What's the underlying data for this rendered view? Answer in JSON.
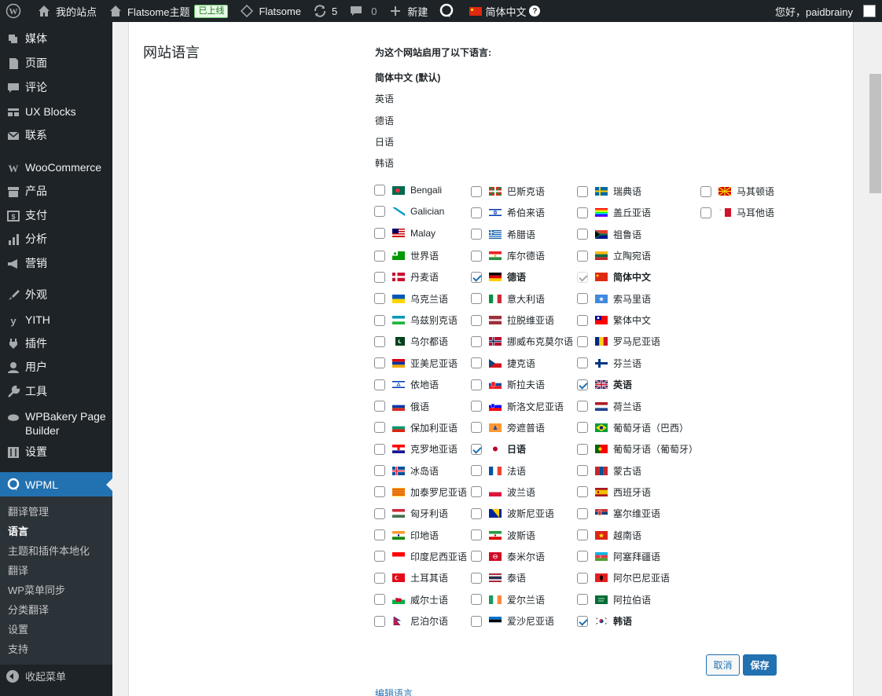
{
  "adminbar": {
    "site_name": "我的站点",
    "theme_name": "Flatsome主题",
    "live_badge": "已上线",
    "flatsome": "Flatsome",
    "updates_count": "5",
    "comments_count": "0",
    "new_label": "新建",
    "language": "简体中文",
    "help": "?",
    "greeting": "您好，paidbrainy"
  },
  "sidebar": {
    "items": [
      {
        "label": "媒体",
        "icon": "media-icon"
      },
      {
        "label": "页面",
        "icon": "page-icon"
      },
      {
        "label": "评论",
        "icon": "comment-icon"
      },
      {
        "label": "UX Blocks",
        "icon": "blocks-icon"
      },
      {
        "label": "联系",
        "icon": "mail-icon"
      },
      {
        "label": "WooCommerce",
        "icon": "woo-icon"
      },
      {
        "label": "产品",
        "icon": "archive-icon"
      },
      {
        "label": "支付",
        "icon": "payment-icon"
      },
      {
        "label": "分析",
        "icon": "chart-icon"
      },
      {
        "label": "营销",
        "icon": "megaphone-icon"
      },
      {
        "label": "外观",
        "icon": "brush-icon"
      },
      {
        "label": "YITH",
        "icon": "yith-icon"
      },
      {
        "label": "插件",
        "icon": "plugin-icon"
      },
      {
        "label": "用户",
        "icon": "user-icon"
      },
      {
        "label": "工具",
        "icon": "wrench-icon"
      },
      {
        "label": "WPBakery Page Builder",
        "icon": "wpbakery-icon"
      },
      {
        "label": "设置",
        "icon": "settings-icon"
      },
      {
        "label": "WPML",
        "icon": "wpml-icon"
      }
    ],
    "submenu": [
      "翻译管理",
      "语言",
      "主题和插件本地化",
      "翻译",
      "WP菜单同步",
      "分类翻译",
      "设置",
      "支持"
    ],
    "collapse": "收起菜单"
  },
  "main": {
    "section_title": "网站语言",
    "enabled_heading": "为这个网站启用了以下语言:",
    "enabled_languages": [
      "简体中文 (默认)",
      "英语",
      "德语",
      "日语",
      "韩语"
    ],
    "columns": [
      [
        {
          "name": "Bengali",
          "checked": false,
          "flag": "bd"
        },
        {
          "name": "Galician",
          "checked": false,
          "flag": "gl"
        },
        {
          "name": "Malay",
          "checked": false,
          "flag": "my"
        },
        {
          "name": "世界语",
          "checked": false,
          "flag": "eo"
        },
        {
          "name": "丹麦语",
          "checked": false,
          "flag": "dk"
        },
        {
          "name": "乌克兰语",
          "checked": false,
          "flag": "ua"
        },
        {
          "name": "乌兹别克语",
          "checked": false,
          "flag": "uz"
        },
        {
          "name": "乌尔都语",
          "checked": false,
          "flag": "pk"
        },
        {
          "name": "亚美尼亚语",
          "checked": false,
          "flag": "am"
        },
        {
          "name": "依地语",
          "checked": false,
          "flag": "yi"
        },
        {
          "name": "俄语",
          "checked": false,
          "flag": "ru"
        },
        {
          "name": "保加利亚语",
          "checked": false,
          "flag": "bg"
        },
        {
          "name": "克罗地亚语",
          "checked": false,
          "flag": "hr"
        },
        {
          "name": "冰岛语",
          "checked": false,
          "flag": "is"
        },
        {
          "name": "加泰罗尼亚语",
          "checked": false,
          "flag": "ca"
        },
        {
          "name": "匈牙利语",
          "checked": false,
          "flag": "hu"
        },
        {
          "name": "印地语",
          "checked": false,
          "flag": "in"
        },
        {
          "name": "印度尼西亚语",
          "checked": false,
          "flag": "id"
        },
        {
          "name": "土耳其语",
          "checked": false,
          "flag": "tr"
        },
        {
          "name": "威尔士语",
          "checked": false,
          "flag": "wales"
        },
        {
          "name": "尼泊尔语",
          "checked": false,
          "flag": "np"
        }
      ],
      [
        {
          "name": "巴斯克语",
          "checked": false,
          "flag": "eu"
        },
        {
          "name": "希伯来语",
          "checked": false,
          "flag": "il"
        },
        {
          "name": "希腊语",
          "checked": false,
          "flag": "gr"
        },
        {
          "name": "库尔德语",
          "checked": false,
          "flag": "ku"
        },
        {
          "name": "德语",
          "checked": true,
          "flag": "de"
        },
        {
          "name": "意大利语",
          "checked": false,
          "flag": "it"
        },
        {
          "name": "拉脱维亚语",
          "checked": false,
          "flag": "lv"
        },
        {
          "name": "挪威布克莫尔语",
          "checked": false,
          "flag": "no"
        },
        {
          "name": "捷克语",
          "checked": false,
          "flag": "cz"
        },
        {
          "name": "斯拉夫语",
          "checked": false,
          "flag": "sk"
        },
        {
          "name": "斯洛文尼亚语",
          "checked": false,
          "flag": "si"
        },
        {
          "name": "旁遮普语",
          "checked": false,
          "flag": "pa"
        },
        {
          "name": "日语",
          "checked": true,
          "flag": "jp"
        },
        {
          "name": "法语",
          "checked": false,
          "flag": "fr"
        },
        {
          "name": "波兰语",
          "checked": false,
          "flag": "pl"
        },
        {
          "name": "波斯尼亚语",
          "checked": false,
          "flag": "ba"
        },
        {
          "name": "波斯语",
          "checked": false,
          "flag": "ir"
        },
        {
          "name": "泰米尔语",
          "checked": false,
          "flag": "ta"
        },
        {
          "name": "泰语",
          "checked": false,
          "flag": "th"
        },
        {
          "name": "爱尔兰语",
          "checked": false,
          "flag": "ie"
        },
        {
          "name": "爱沙尼亚语",
          "checked": false,
          "flag": "ee"
        }
      ],
      [
        {
          "name": "瑞典语",
          "checked": false,
          "flag": "se"
        },
        {
          "name": "盖丘亚语",
          "checked": false,
          "flag": "qu"
        },
        {
          "name": "祖鲁语",
          "checked": false,
          "flag": "za"
        },
        {
          "name": "立陶宛语",
          "checked": false,
          "flag": "lt"
        },
        {
          "name": "简体中文",
          "checked": true,
          "flag": "cn",
          "disabled": true
        },
        {
          "name": "索马里语",
          "checked": false,
          "flag": "so"
        },
        {
          "name": "繁体中文",
          "checked": false,
          "flag": "tw"
        },
        {
          "name": "罗马尼亚语",
          "checked": false,
          "flag": "ro"
        },
        {
          "name": "芬兰语",
          "checked": false,
          "flag": "fi"
        },
        {
          "name": "英语",
          "checked": true,
          "flag": "gb"
        },
        {
          "name": "荷兰语",
          "checked": false,
          "flag": "nl"
        },
        {
          "name": "葡萄牙语（巴西）",
          "checked": false,
          "flag": "br"
        },
        {
          "name": "葡萄牙语（葡萄牙）",
          "checked": false,
          "flag": "pt"
        },
        {
          "name": "蒙古语",
          "checked": false,
          "flag": "mn"
        },
        {
          "name": "西班牙语",
          "checked": false,
          "flag": "es"
        },
        {
          "name": "塞尔维亚语",
          "checked": false,
          "flag": "rs"
        },
        {
          "name": "越南语",
          "checked": false,
          "flag": "vn"
        },
        {
          "name": "阿塞拜疆语",
          "checked": false,
          "flag": "az"
        },
        {
          "name": "阿尔巴尼亚语",
          "checked": false,
          "flag": "al"
        },
        {
          "name": "阿拉伯语",
          "checked": false,
          "flag": "sa"
        },
        {
          "name": "韩语",
          "checked": true,
          "flag": "kr"
        }
      ],
      [
        {
          "name": "马其顿语",
          "checked": false,
          "flag": "mk"
        },
        {
          "name": "马耳他语",
          "checked": false,
          "flag": "mt"
        }
      ]
    ],
    "cancel_label": "取消",
    "save_label": "保存",
    "edit_link": "编辑语言"
  }
}
